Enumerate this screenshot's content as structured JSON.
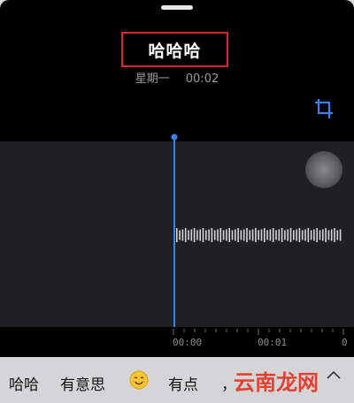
{
  "recording": {
    "title": "哈哈哈",
    "day": "星期一",
    "duration": "00:02"
  },
  "ruler": {
    "labels": [
      "00:00",
      "00:01",
      "0"
    ]
  },
  "keyboard": {
    "suggestions": [
      "哈哈",
      "有意思",
      "有点",
      "，"
    ],
    "emoji_icon": "smiling-face-emoji"
  },
  "watermark": "云南龙网",
  "colors": {
    "accent_blue": "#3d7ef0",
    "highlight_red": "#e0242b",
    "watermark_red": "#e53a2a"
  }
}
